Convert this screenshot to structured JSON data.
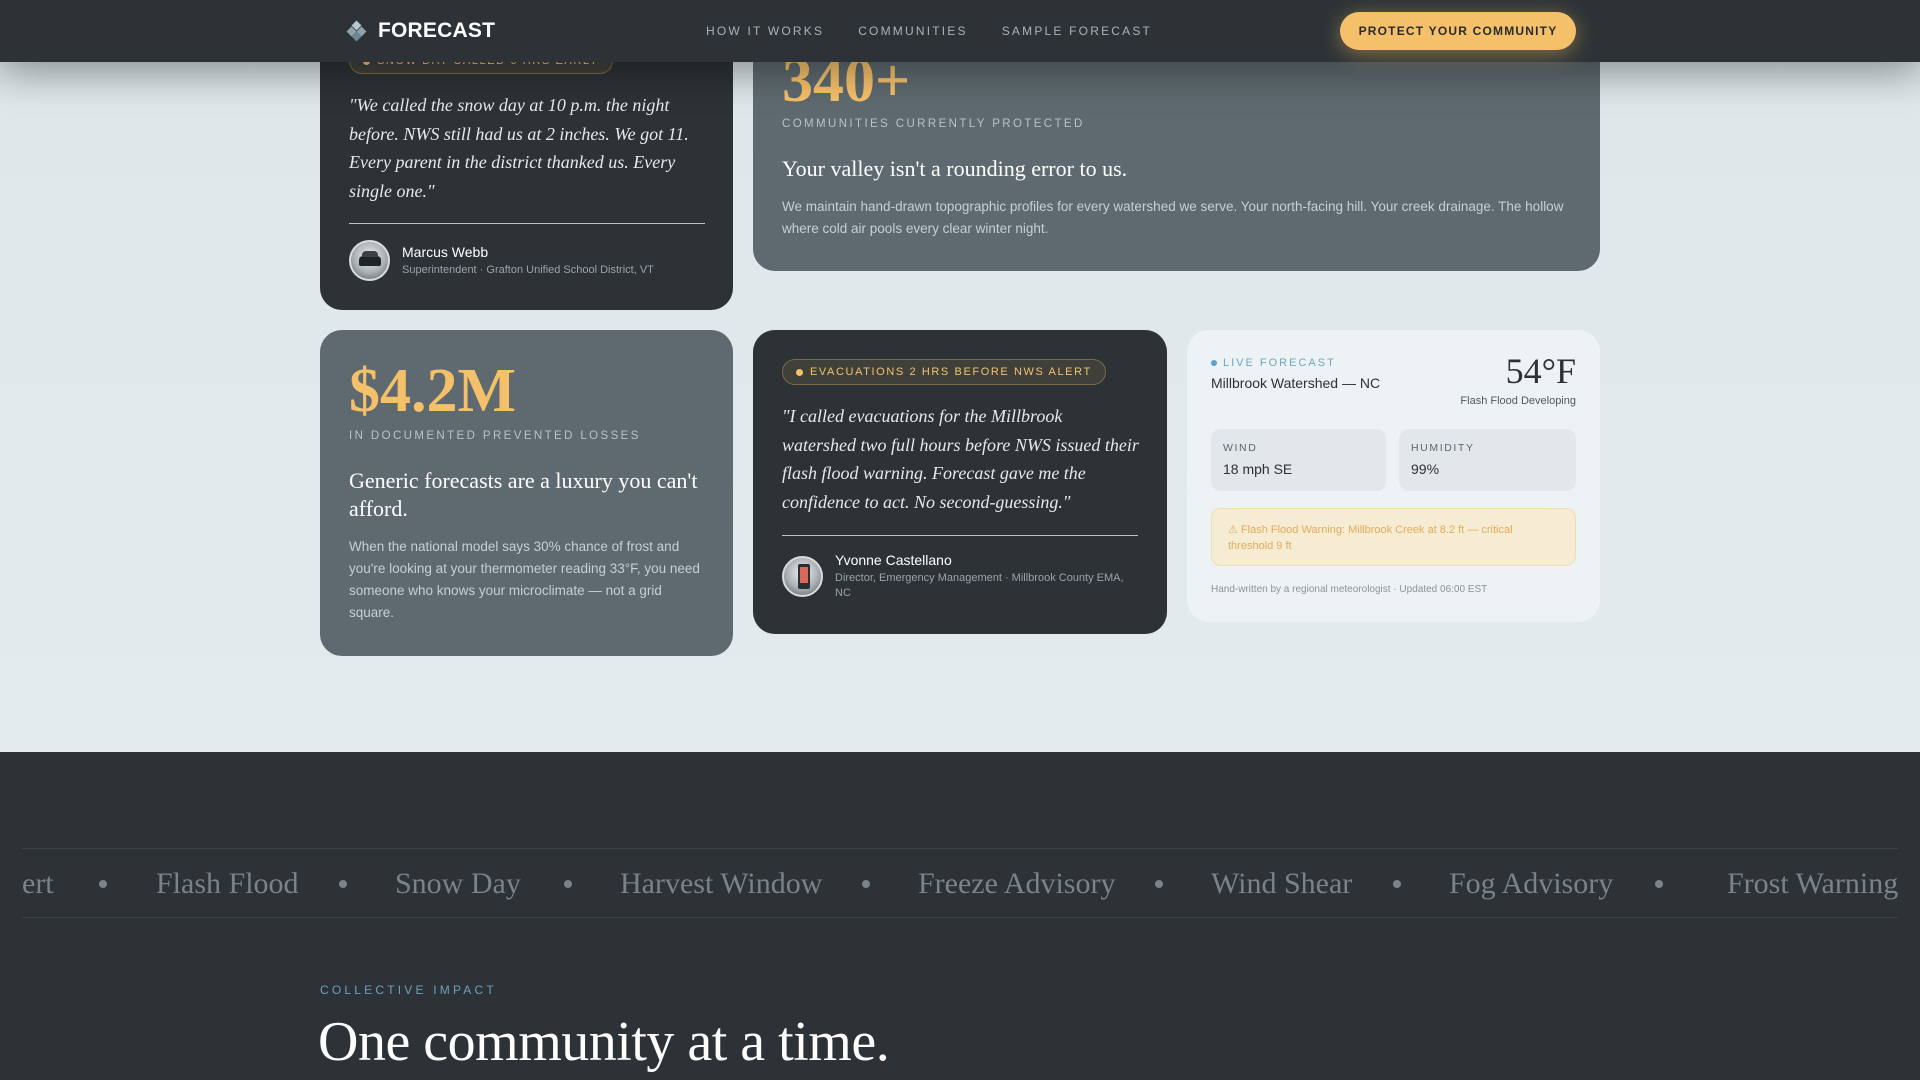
{
  "nav": {
    "brand": "FORECAST",
    "links": [
      "HOW IT WORKS",
      "COMMUNITIES",
      "SAMPLE FORECAST"
    ],
    "cta": "PROTECT YOUR COMMUNITY"
  },
  "testimonial_1": {
    "badge": "SNOW DAY CALLED 6 HRS EARLY",
    "quote": "\"We called the snow day at 10 p.m. the night before. NWS still had us at 2 inches. We got 11. Every parent in the district thanked us. Every single one.\"",
    "name": "Marcus Webb",
    "role": "Superintendent · Grafton Unified School District, VT"
  },
  "stat_1": {
    "value": "340+",
    "label": "COMMUNITIES CURRENTLY PROTECTED",
    "heading": "Your valley isn't a rounding error to us.",
    "body": "We maintain hand-drawn topographic profiles for every watershed we serve. Your north-facing hill. Your creek drainage. The hollow where cold air pools every clear winter night."
  },
  "stat_2": {
    "value": "$4.2M",
    "label": "IN DOCUMENTED PREVENTED LOSSES",
    "heading": "Generic forecasts are a luxury you can't afford.",
    "body": "When the national model says 30% chance of frost and you're looking at your thermometer reading 33°F, you need someone who knows your microclimate — not a grid square."
  },
  "testimonial_2": {
    "badge": "EVACUATIONS 2 HRS BEFORE NWS ALERT",
    "quote": "\"I called evacuations for the Millbrook watershed two full hours before NWS issued their flash flood warning. Forecast gave me the confidence to act. No second-guessing.\"",
    "name": "Yvonne Castellano",
    "role": "Director, Emergency Management · Millbrook County EMA, NC"
  },
  "widget": {
    "live_label": "LIVE FORECAST",
    "place": "Millbrook Watershed — NC",
    "temp": "54°F",
    "condition": "Flash Flood Developing",
    "wind_label": "WIND",
    "wind_value": "18 mph SE",
    "humidity_label": "HUMIDITY",
    "humidity_value": "99%",
    "alert": "⚠ Flash Flood Warning: Millbrook Creek at 8.2 ft — critical threshold 9 ft",
    "footer": "Hand-written by a regional meteorologist · Updated 06:00 EST"
  },
  "ticker": {
    "items": [
      "ert",
      "Flash Flood",
      "Snow Day",
      "Harvest Window",
      "Freeze Advisory",
      "Wind Shear",
      "Fog Advisory",
      "Frost Warning"
    ]
  },
  "impact": {
    "eyebrow": "COLLECTIVE IMPACT",
    "headline": "One community at a time."
  },
  "colors": {
    "accent": "#f5c06a",
    "dark": "#2c3236",
    "slate": "#5e6a6f",
    "info_blue": "#6ea5c8"
  }
}
